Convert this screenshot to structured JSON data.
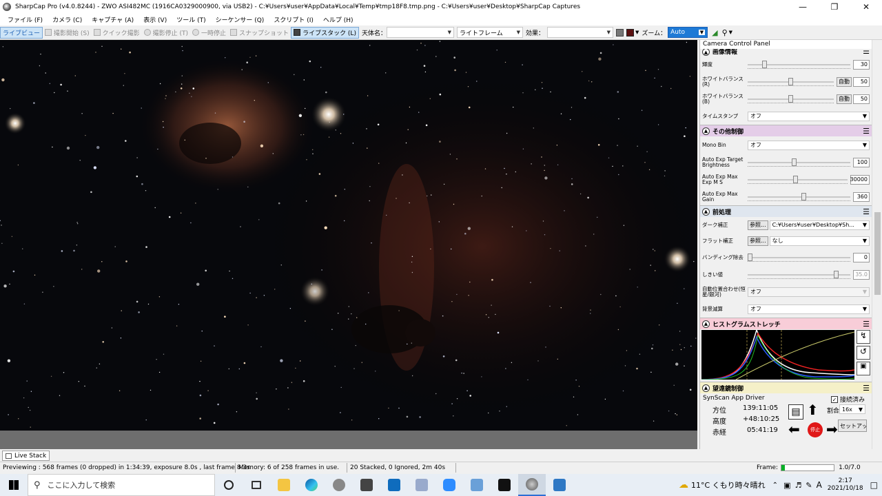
{
  "window": {
    "title": "SharpCap Pro (v4.0.8244) - ZWO ASI482MC (1916CA0329000900, via USB2) - C:¥Users¥user¥AppData¥Local¥Temp¥tmp18F8.tmp.png - C:¥Users¥user¥Desktop¥SharpCap Captures"
  },
  "menu": [
    "ファイル (F)",
    "カメラ (C)",
    "キャプチャ (A)",
    "表示 (V)",
    "ツール (T)",
    "シーケンサー (Q)",
    "スクリプト (I)",
    "ヘルプ (H)"
  ],
  "toolbar": {
    "live_view": "ライブビュー",
    "start_capture": "撮影開始 (S)",
    "quick_capture": "クイック撮影",
    "stop_capture": "撮影停止 (T)",
    "pause": "一時停止",
    "snapshot": "スナップショット",
    "live_stack": "ライブスタック (L)",
    "target_label": "天体名：",
    "target_value": "",
    "frame_type": "ライトフレーム",
    "effect_label": "効果：",
    "effect_value": "",
    "zoom_label": "ズーム：",
    "zoom_value": "Auto"
  },
  "panel": {
    "title": "Camera Control Panel",
    "image_section": {
      "title": "画像情報",
      "brightness_label": "輝度",
      "brightness_value": "30",
      "brightness_level": 0.15,
      "wb_r_label": "ホワイトバランス(R)",
      "wb_r_value": "50",
      "wb_r_level": 0.5,
      "wb_b_label": "ホワイトバランス(B)",
      "wb_b_value": "50",
      "wb_b_level": 0.5,
      "auto_label": "自動",
      "timestamp_label": "タイムスタンプ",
      "timestamp_value": "オフ"
    },
    "other_section": {
      "title": "その他制御",
      "mono_bin_label": "Mono Bin",
      "mono_bin_value": "オフ",
      "target_brightness_label": "Auto Exp Target Brightness",
      "target_brightness_value": "100",
      "target_brightness_level": 0.45,
      "max_exp_label": "Auto Exp Max Exp M S",
      "max_exp_value": "30000",
      "max_exp_level": 0.48,
      "max_gain_label": "Auto Exp Max Gain",
      "max_gain_value": "360",
      "max_gain_level": 0.55
    },
    "preprocess_section": {
      "title": "前処理",
      "dark_label": "ダーク補正",
      "browse_label": "参照...",
      "dark_value": "C:¥Users¥user¥Desktop¥Sh...",
      "flat_label": "フラット補正",
      "flat_value": "なし",
      "banding_label": "バンディング除去",
      "banding_value": "0",
      "banding_level": 0.0,
      "threshold_label": "しきい値",
      "threshold_value": "35.0",
      "threshold_level": 0.88,
      "auto_align_label": "自動位置合わせ(恒星/銀河)",
      "auto_align_value": "オフ",
      "bg_sub_label": "背景減算",
      "bg_sub_value": "オフ"
    },
    "histogram_section": {
      "title": "ヒストグラムストレッチ"
    },
    "telescope_section": {
      "title": "望遠鏡制御",
      "driver": "SynScan App Driver",
      "connected_label": "接続済み",
      "ra_label": "方位",
      "ra_value": "139:11:05",
      "alt_label": "高度",
      "alt_value": "+48:10:25",
      "dec_label": "赤経",
      "dec_value": "05:41:19",
      "rate_label": "割合:",
      "rate_value": "16x",
      "stop_label": "停止",
      "setup_label": "セットアップ"
    }
  },
  "tab": {
    "label": "Live Stack"
  },
  "status": {
    "preview": "Previewing : 568 frames (0 dropped) in 1:34:39, exposure 8.0s , last frame 8.3s",
    "memory": "Memory: 6 of 258 frames in use.",
    "stack": "20 Stacked, 0 Ignored, 2m 40s",
    "frame_label": "Frame:",
    "frame_value": "1.0/7.0"
  },
  "taskbar": {
    "search_placeholder": "ここに入力して検索",
    "weather": "11°C くもり時々晴れ",
    "ime": "A",
    "time": "2:17",
    "date": "2021/10/18"
  }
}
